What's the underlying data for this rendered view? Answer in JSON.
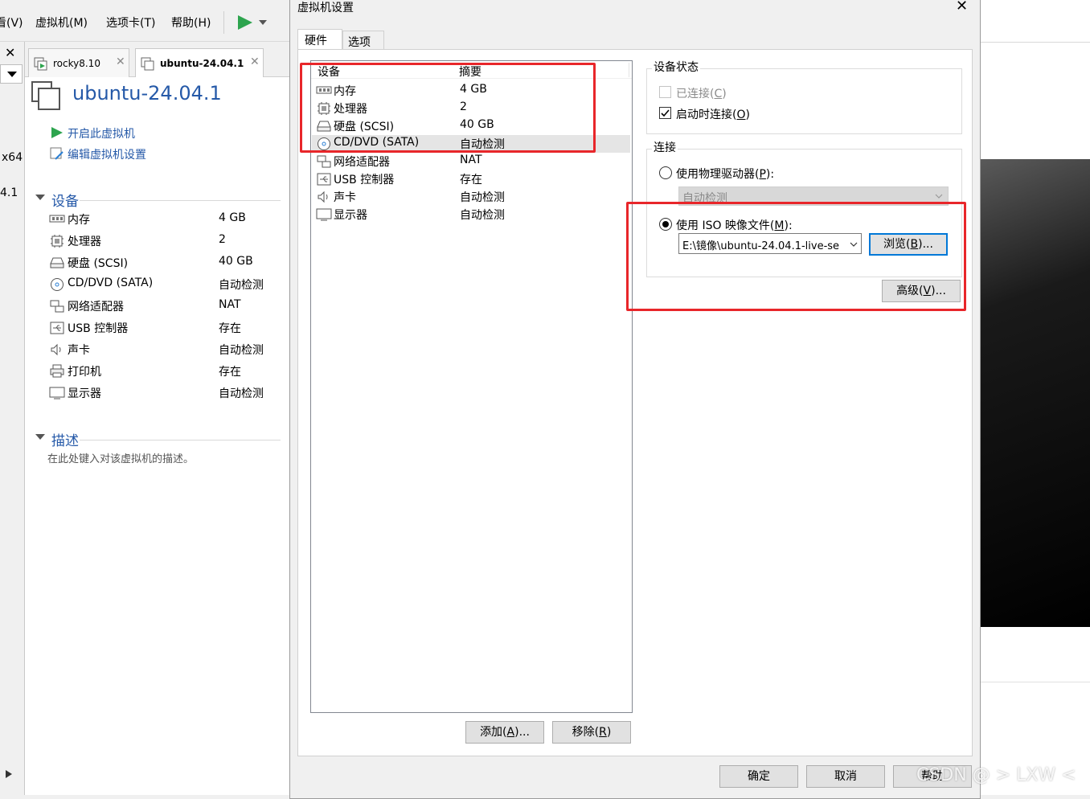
{
  "menubar": {
    "items": [
      "看(V)",
      "虚拟机(M)",
      "选项卡(T)",
      "帮助(H)"
    ]
  },
  "left_strip": {
    "texts": [
      "x64",
      "4.1"
    ]
  },
  "vm_tabs": [
    {
      "label": "rocky8.10"
    },
    {
      "label": "ubuntu-24.04.1"
    }
  ],
  "vm": {
    "title": "ubuntu-24.04.1",
    "actions": [
      "开启此虚拟机",
      "编辑虚拟机设置"
    ],
    "devices_header": "设备",
    "devices": [
      {
        "icon": "memory-icon",
        "name": "内存",
        "value": "4 GB"
      },
      {
        "icon": "cpu-icon",
        "name": "处理器",
        "value": "2"
      },
      {
        "icon": "disk-icon",
        "name": "硬盘 (SCSI)",
        "value": "40 GB"
      },
      {
        "icon": "cd-icon",
        "name": "CD/DVD (SATA)",
        "value": "自动检测"
      },
      {
        "icon": "network-icon",
        "name": "网络适配器",
        "value": "NAT"
      },
      {
        "icon": "usb-icon",
        "name": "USB 控制器",
        "value": "存在"
      },
      {
        "icon": "speaker-icon",
        "name": "声卡",
        "value": "自动检测"
      },
      {
        "icon": "printer-icon",
        "name": "打印机",
        "value": "存在"
      },
      {
        "icon": "display-icon",
        "name": "显示器",
        "value": "自动检测"
      }
    ],
    "description_header": "描述",
    "description_placeholder": "在此处键入对该虚拟机的描述。"
  },
  "dialog": {
    "title": "虚拟机设置",
    "tabs": [
      "硬件",
      "选项"
    ],
    "hardware_table": {
      "columns": [
        "设备",
        "摘要"
      ],
      "rows": [
        {
          "icon": "memory-icon",
          "name": "内存",
          "value": "4 GB"
        },
        {
          "icon": "cpu-icon",
          "name": "处理器",
          "value": "2"
        },
        {
          "icon": "disk-icon",
          "name": "硬盘 (SCSI)",
          "value": "40 GB"
        },
        {
          "icon": "cd-icon",
          "name": "CD/DVD (SATA)",
          "value": "自动检测",
          "selected": true
        },
        {
          "icon": "network-icon",
          "name": "网络适配器",
          "value": "NAT"
        },
        {
          "icon": "usb-icon",
          "name": "USB 控制器",
          "value": "存在"
        },
        {
          "icon": "speaker-icon",
          "name": "声卡",
          "value": "自动检测"
        },
        {
          "icon": "display-icon",
          "name": "显示器",
          "value": "自动检测"
        }
      ]
    },
    "add_button": {
      "text": "添加(",
      "key": "A",
      "tail": ")..."
    },
    "remove_button": {
      "text": "移除(",
      "key": "R",
      "tail": ")"
    },
    "device_status": {
      "title": "设备状态",
      "connected": {
        "text": "已连接(",
        "key": "C",
        "tail": ")",
        "checked": false,
        "enabled": false
      },
      "connect_on_start": {
        "text": "启动时连接(",
        "key": "O",
        "tail": ")",
        "checked": true
      }
    },
    "connection": {
      "title": "连接",
      "physical": {
        "text": "使用物理驱动器(",
        "key": "P",
        "tail": "):",
        "selected": false
      },
      "physical_select_value": "自动检测",
      "iso": {
        "text": "使用 ISO 映像文件(",
        "key": "M",
        "tail": "):",
        "selected": true
      },
      "iso_path": "E:\\镜像\\ubuntu-24.04.1-live-se",
      "browse_button": {
        "text": "浏览(",
        "key": "B",
        "tail": ")..."
      },
      "advanced_button": {
        "text": "高级(",
        "key": "V",
        "tail": ")..."
      }
    },
    "footer_buttons": [
      "确定",
      "取消",
      "帮助"
    ]
  },
  "watermark": "CSDN @ > LXW <"
}
